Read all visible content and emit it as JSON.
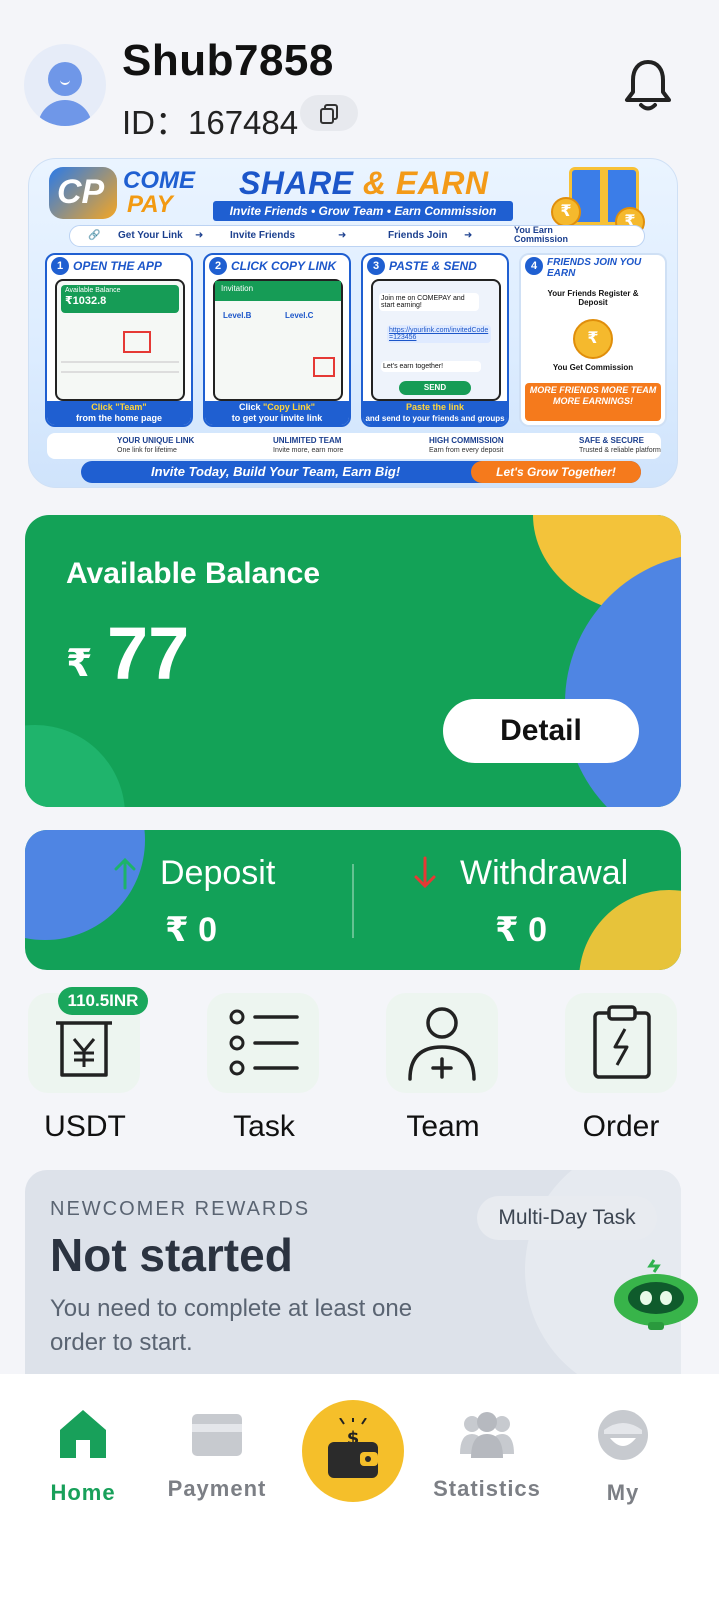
{
  "header": {
    "username": "Shub7858",
    "id_text": "ID：167484"
  },
  "banner": {
    "brand_line1": "COME",
    "brand_line2": "PAY",
    "title_share": "SHARE",
    "title_amp": "&",
    "title_earn": "EARN",
    "subtitle": "Invite Friends • Grow Team • Earn Commission",
    "flow": [
      "Get Your Link",
      "Invite Friends",
      "Friends Join",
      "You Earn Commission"
    ],
    "steps": [
      {
        "num": "1",
        "title": "OPEN THE APP",
        "foot1": "Click \"Team\"",
        "foot2": "from the home page",
        "balance_label": "Available Balance",
        "balance": "₹1032.8"
      },
      {
        "num": "2",
        "title": "CLICK COPY LINK",
        "foot1": "Click \"Copy Link\"",
        "foot2": "to get your invite link",
        "screen_title": "Invitation",
        "levels": [
          "Level.B",
          "Level.C"
        ]
      },
      {
        "num": "3",
        "title": "PASTE & SEND",
        "foot1": "Paste the link",
        "foot2": "and send to your friends and groups",
        "msg1": "Join me on COMEPAY and start earning!",
        "msg2": "https://yourlink.com/invitedCode=123456",
        "msg3": "Let's earn together!",
        "send": "SEND"
      },
      {
        "num": "4",
        "title": "FRIENDS JOIN YOU EARN",
        "line1": "Your Friends Register & Deposit",
        "line2": "You Get Commission",
        "promo": "MORE FRIENDS MORE TEAM MORE EARNINGS!"
      }
    ],
    "features": [
      {
        "title": "YOUR UNIQUE LINK",
        "sub": "One link for lifetime"
      },
      {
        "title": "UNLIMITED TEAM",
        "sub": "Invite more, earn more"
      },
      {
        "title": "HIGH COMMISSION",
        "sub": "Earn from every deposit"
      },
      {
        "title": "SAFE & SECURE",
        "sub": "Trusted & reliable platform"
      }
    ],
    "footer": "Invite Today, Build Your Team, Earn Big!",
    "footer_pill": "Let's Grow Together!"
  },
  "balance": {
    "label": "Available Balance",
    "currency": "₹",
    "amount": "77",
    "detail_button": "Detail"
  },
  "flows": {
    "deposit_label": "Deposit",
    "deposit_value": "₹ 0",
    "withdrawal_label": "Withdrawal",
    "withdrawal_value": "₹ 0"
  },
  "quick_actions": {
    "usdt": "USDT",
    "usdt_badge": "110.5INR",
    "task": "Task",
    "team": "Team",
    "order": "Order"
  },
  "newcomer": {
    "kicker": "NEWCOMER REWARDS",
    "title": "Not started",
    "description": "You need to complete at least one order to start.",
    "tag": "Multi-Day Task"
  },
  "nav": {
    "home": "Home",
    "payment": "Payment",
    "statistics": "Statistics",
    "my": "My"
  },
  "colors": {
    "primary_green": "#13a257",
    "accent_yellow": "#f5bf2a",
    "accent_blue": "#4f85e3"
  }
}
